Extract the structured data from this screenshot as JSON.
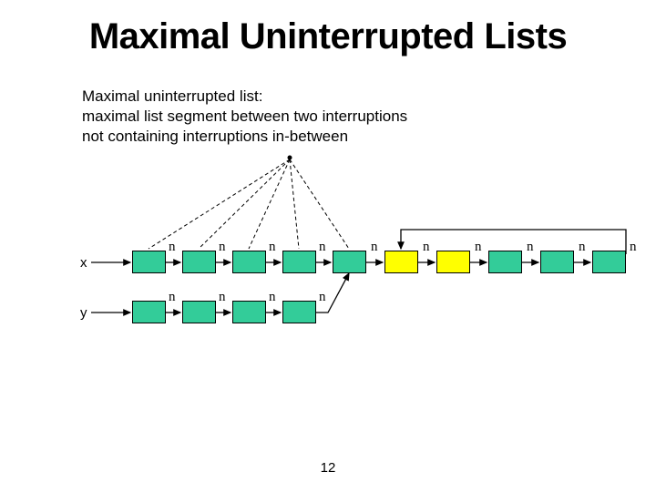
{
  "title": "Maximal Uninterrupted Lists",
  "description": {
    "line1": "Maximal uninterrupted list:",
    "line2": "maximal list segment between two interruptions",
    "line3": "not containing interruptions in-between"
  },
  "lists": {
    "x": {
      "label": "x",
      "edge_label": "n",
      "box_colors": [
        "#33cc99",
        "#33cc99",
        "#33cc99",
        "#33cc99",
        "#33cc99",
        "#ffff00",
        "#ffff00",
        "#33cc99",
        "#33cc99",
        "#33cc99"
      ]
    },
    "y": {
      "label": "y",
      "edge_label": "n",
      "box_colors": [
        "#33cc99",
        "#33cc99",
        "#33cc99",
        "#33cc99"
      ]
    }
  },
  "page_number": "12"
}
